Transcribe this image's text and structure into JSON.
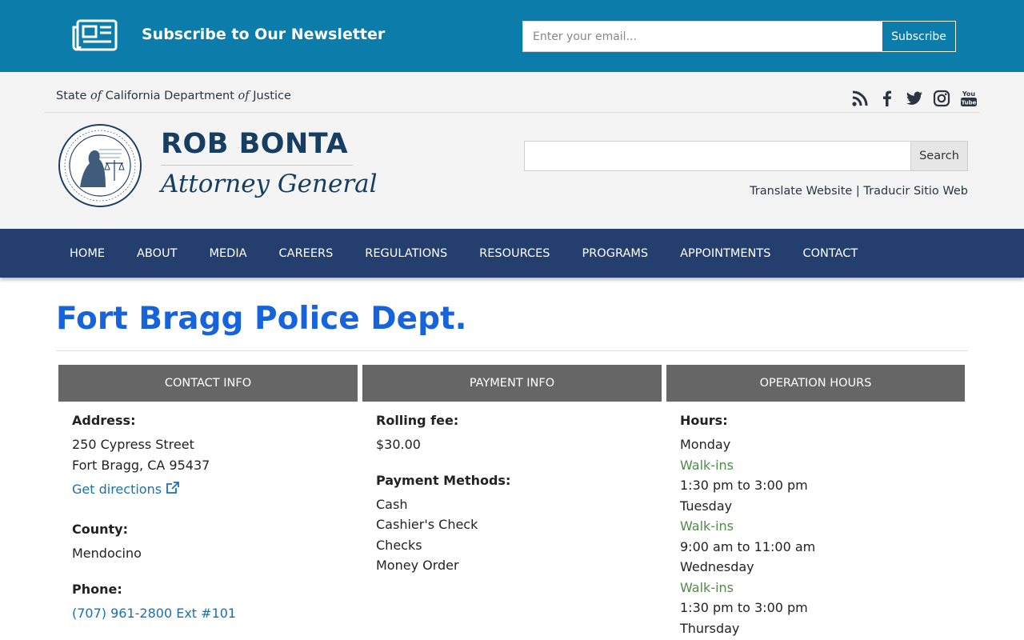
{
  "newsletter": {
    "title": "Subscribe to Our Newsletter",
    "email_placeholder": "Enter your email...",
    "subscribe_label": "Subscribe"
  },
  "header": {
    "state_prefix": "State ",
    "state_of1": "of",
    "state_middle": " California Department ",
    "state_of2": "of",
    "state_suffix": " Justice",
    "social_icons": [
      "rss-icon",
      "facebook-icon",
      "twitter-icon",
      "instagram-icon",
      "youtube-icon"
    ],
    "ag_name": "ROB BONTA",
    "ag_title": "Attorney General",
    "search_label": "Search",
    "translate_en": "Translate Website",
    "translate_sep": "|",
    "translate_es": "Traducir Sitio Web"
  },
  "nav": {
    "items": [
      "HOME",
      "ABOUT",
      "MEDIA",
      "CAREERS",
      "REGULATIONS",
      "RESOURCES",
      "PROGRAMS",
      "APPOINTMENTS",
      "CONTACT"
    ]
  },
  "page": {
    "title": "Fort Bragg Police Dept."
  },
  "columns": {
    "contact_header": "CONTACT INFO",
    "payment_header": "PAYMENT INFO",
    "hours_header": "OPERATION HOURS"
  },
  "contact": {
    "address_label": "Address:",
    "address_line1": "250 Cypress Street",
    "address_line2": "Fort Bragg, CA 95437",
    "directions": "Get directions",
    "county_label": "County:",
    "county": "Mendocino",
    "phone_label": "Phone:",
    "phone": "(707) 961-2800 Ext #101"
  },
  "payment": {
    "rolling_fee_label": "Rolling fee:",
    "rolling_fee": "$30.00",
    "methods_label": "Payment Methods:",
    "methods": [
      "Cash",
      "Cashier's Check",
      "Checks",
      "Money Order"
    ]
  },
  "hours": {
    "label": "Hours:",
    "schedule": [
      {
        "day": "Monday",
        "type": "Walk-ins",
        "time": "1:30 pm to 3:00 pm"
      },
      {
        "day": "Tuesday",
        "type": "Walk-ins",
        "time": "9:00 am to 11:00 am"
      },
      {
        "day": "Wednesday",
        "type": "Walk-ins",
        "time": "1:30 pm to 3:00 pm"
      },
      {
        "day": "Thursday"
      }
    ]
  },
  "colors": {
    "newsletter_bg": "#0c7cab",
    "nav_bg": "#243f6e",
    "title": "#1763dc",
    "link": "#1b6fae",
    "walkin": "#4f8a4a",
    "column_header": "#666666"
  }
}
